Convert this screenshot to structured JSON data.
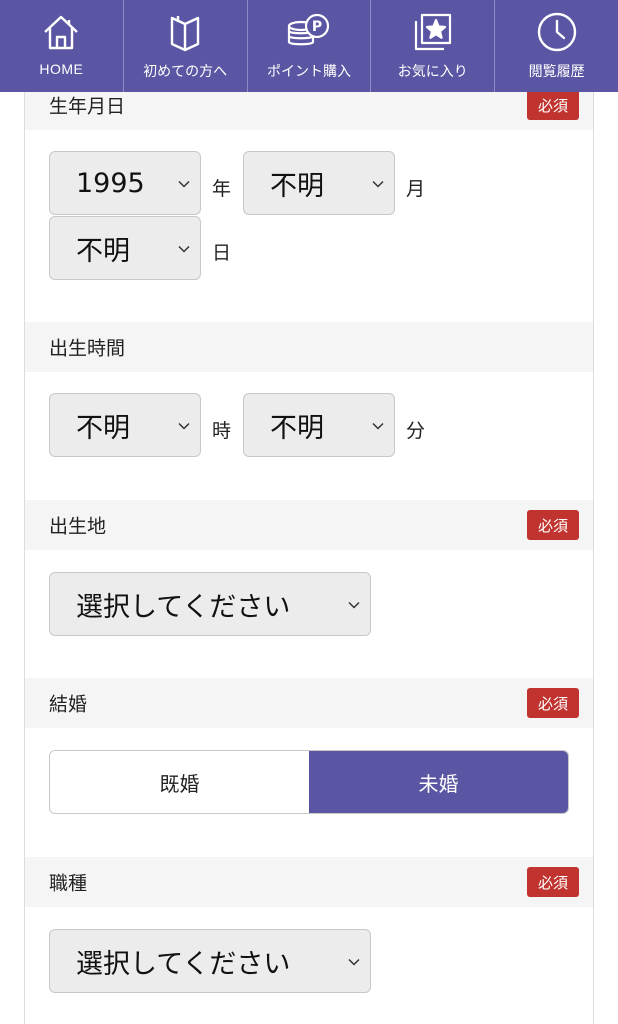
{
  "nav": {
    "items": [
      {
        "label": "HOME",
        "icon": "home-icon"
      },
      {
        "label": "初めての方へ",
        "icon": "book-icon"
      },
      {
        "label": "ポイント購入",
        "icon": "coins-icon"
      },
      {
        "label": "お気に入り",
        "icon": "star-icon"
      },
      {
        "label": "閲覧履歴",
        "icon": "clock-icon"
      }
    ]
  },
  "required_label": "必須",
  "birthdate": {
    "title": "生年月日",
    "year": "1995",
    "year_unit": "年",
    "month": "不明",
    "month_unit": "月",
    "day": "不明",
    "day_unit": "日"
  },
  "birthtime": {
    "title": "出生時間",
    "hour": "不明",
    "hour_unit": "時",
    "minute": "不明",
    "minute_unit": "分"
  },
  "birthplace": {
    "title": "出生地",
    "value": "選択してください"
  },
  "marriage": {
    "title": "結婚",
    "options": [
      "既婚",
      "未婚"
    ],
    "selected": "未婚"
  },
  "occupation": {
    "title": "職種",
    "value": "選択してください"
  },
  "colors": {
    "brand": "#5b56a3",
    "required": "#c0332f"
  }
}
